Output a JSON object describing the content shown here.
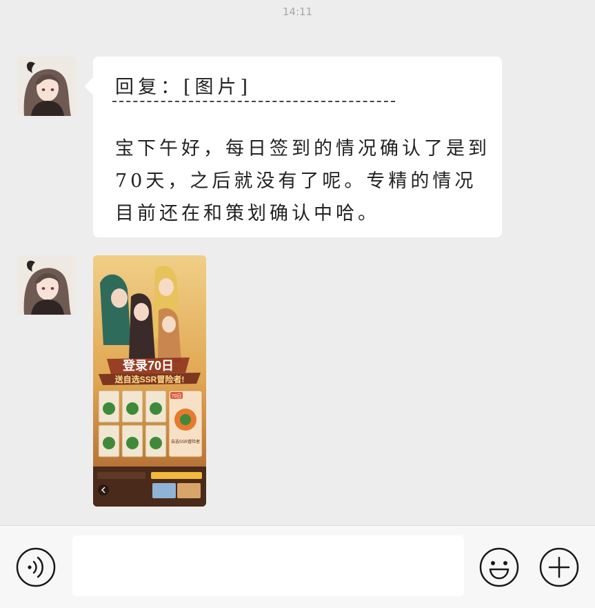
{
  "header": {
    "time": "14:11"
  },
  "messages": [
    {
      "type": "text",
      "sender_avatar": "girl-avatar",
      "quote": "回复：[图片]",
      "divider": "-------------------",
      "text": "宝下午好，每日签到的情况确认了是到70天，之后就没有了呢。专精的情况目前还在和策划确认中哈。"
    },
    {
      "type": "image",
      "sender_avatar": "girl-avatar",
      "image": {
        "banner_title": "登录70日",
        "banner_subtitle": "送自选SSR冒险者!",
        "day_badge": "70日",
        "reward_label": "自选SSR冒险者"
      }
    }
  ],
  "composer": {
    "voice_icon": "voice-icon",
    "emoji_icon": "emoji-icon",
    "plus_icon": "plus-icon",
    "input_value": ""
  },
  "colors": {
    "background": "#ededed",
    "bubble": "#ffffff",
    "composer": "#f7f7f7"
  }
}
